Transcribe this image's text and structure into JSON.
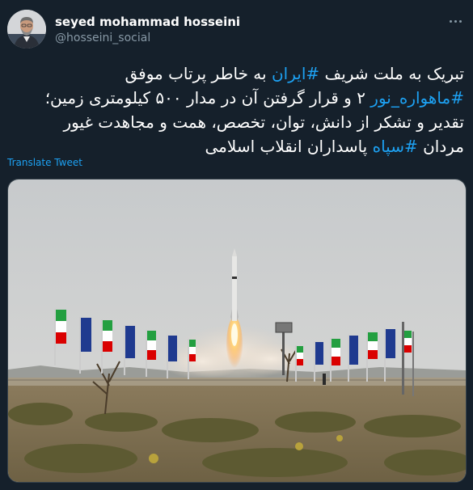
{
  "user": {
    "display_name": "seyed mohammad hosseini",
    "handle": "@hosseini_social",
    "avatar_icon": "user-avatar"
  },
  "tweet": {
    "lines": [
      [
        {
          "text": "تبریک به ملت شریف ",
          "hashtag": false
        },
        {
          "text": "#ایران",
          "hashtag": true
        },
        {
          "text": " به خاطر پرتاب موفق",
          "hashtag": false
        }
      ],
      [
        {
          "text": "#ماهواره_نور",
          "hashtag": true
        },
        {
          "text": " ۲ و قرار گرفتن آن در مدار ۵۰۰ کیلومتری زمین؛",
          "hashtag": false
        }
      ],
      [
        {
          "text": "تقدیر و تشکر از دانش، توان، تخصص، همت و مجاهدت غیور",
          "hashtag": false
        }
      ],
      [
        {
          "text": "مردان ",
          "hashtag": false
        },
        {
          "text": "#سپاه",
          "hashtag": true
        },
        {
          "text": " پاسداران انقلاب اسلامی",
          "hashtag": false
        }
      ]
    ],
    "translate_label": "Translate Tweet"
  },
  "colors": {
    "background": "#15202b",
    "link": "#1da1f2",
    "muted": "#8899a6",
    "border": "#38444d"
  },
  "media": {
    "icon": "rocket-launch-photo"
  }
}
